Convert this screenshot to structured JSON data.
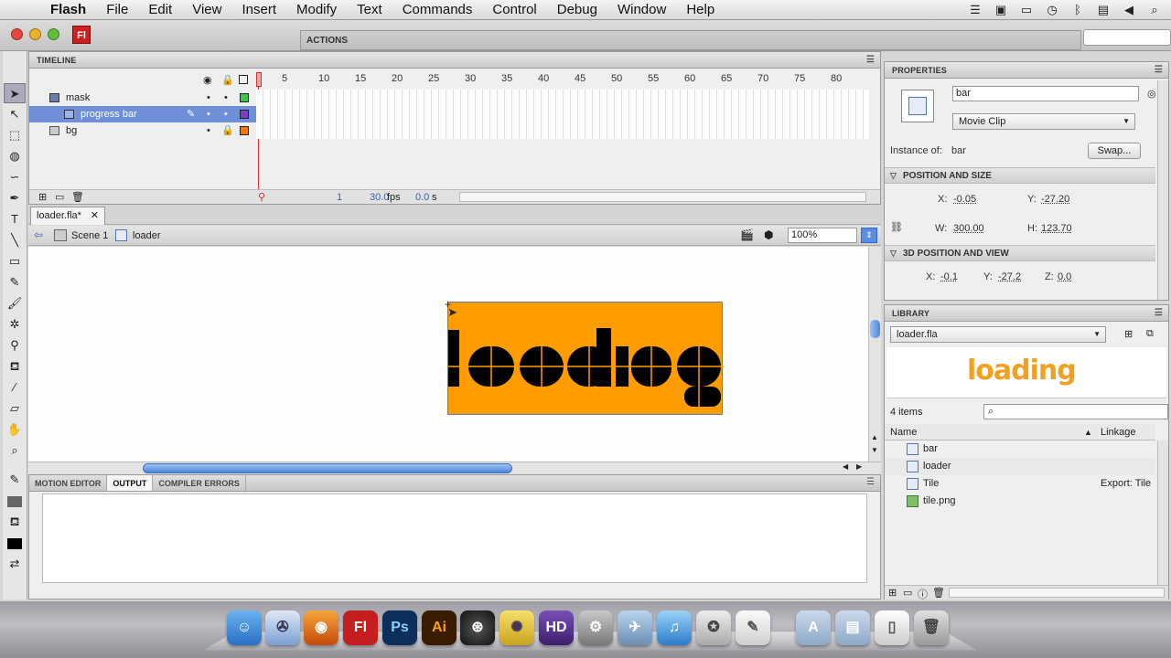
{
  "menubar": {
    "apple_icon": "apple-icon",
    "app_name": "Flash",
    "items": [
      "File",
      "Edit",
      "View",
      "Insert",
      "Modify",
      "Text",
      "Commands",
      "Control",
      "Debug",
      "Window",
      "Help"
    ]
  },
  "window": {
    "app_badge": "Fl",
    "actions_title": "ACTIONS"
  },
  "timeline": {
    "title": "TIMELINE",
    "ruler": [
      "5",
      "10",
      "15",
      "20",
      "25",
      "30",
      "35",
      "40",
      "45",
      "50",
      "55",
      "60",
      "65",
      "70",
      "75",
      "80"
    ],
    "layers": [
      {
        "name": "mask",
        "color": "#39c64a"
      },
      {
        "name": "progress bar",
        "color": "#7a3fc4"
      },
      {
        "name": "bg",
        "color": "#f07a00"
      }
    ],
    "current_frame": "1",
    "fps": "30.0",
    "fps_unit": "fps",
    "time": "0.0",
    "time_unit": "s"
  },
  "document": {
    "tab": "loader.fla*",
    "scene": "Scene 1",
    "symbol": "loader",
    "zoom": "100%",
    "stage_text": "loading"
  },
  "output": {
    "tabs": [
      "MOTION EDITOR",
      "OUTPUT",
      "COMPILER ERRORS"
    ]
  },
  "properties": {
    "title": "PROPERTIES",
    "instance_name": "bar",
    "type": "Movie Clip",
    "instance_of_label": "Instance of:",
    "instance_of": "bar",
    "swap": "Swap...",
    "pos_section": "POSITION AND SIZE",
    "x_label": "X:",
    "x": "-0.05",
    "y_label": "Y:",
    "y": "-27.20",
    "w_label": "W:",
    "w": "300.00",
    "h_label": "H:",
    "h": "123.70",
    "pos3d_section": "3D POSITION AND VIEW",
    "x3": "-0.1",
    "y3": "-27.2",
    "z_label": "Z:",
    "z3": "0.0"
  },
  "library": {
    "title": "LIBRARY",
    "file": "loader.fla",
    "preview_text": "loading",
    "count": "4 items",
    "col_name": "Name",
    "col_linkage": "Linkage",
    "items": [
      {
        "name": "bar",
        "linkage": ""
      },
      {
        "name": "loader",
        "linkage": ""
      },
      {
        "name": "Tile",
        "linkage": "Export: Tile"
      },
      {
        "name": "tile.png",
        "linkage": ""
      }
    ]
  },
  "dock": {
    "fl": "Fl",
    "ps": "Ps",
    "ai": "Ai"
  },
  "colors": {
    "clip_fill": "#ff9d00",
    "selection": "#6f8fd8"
  }
}
